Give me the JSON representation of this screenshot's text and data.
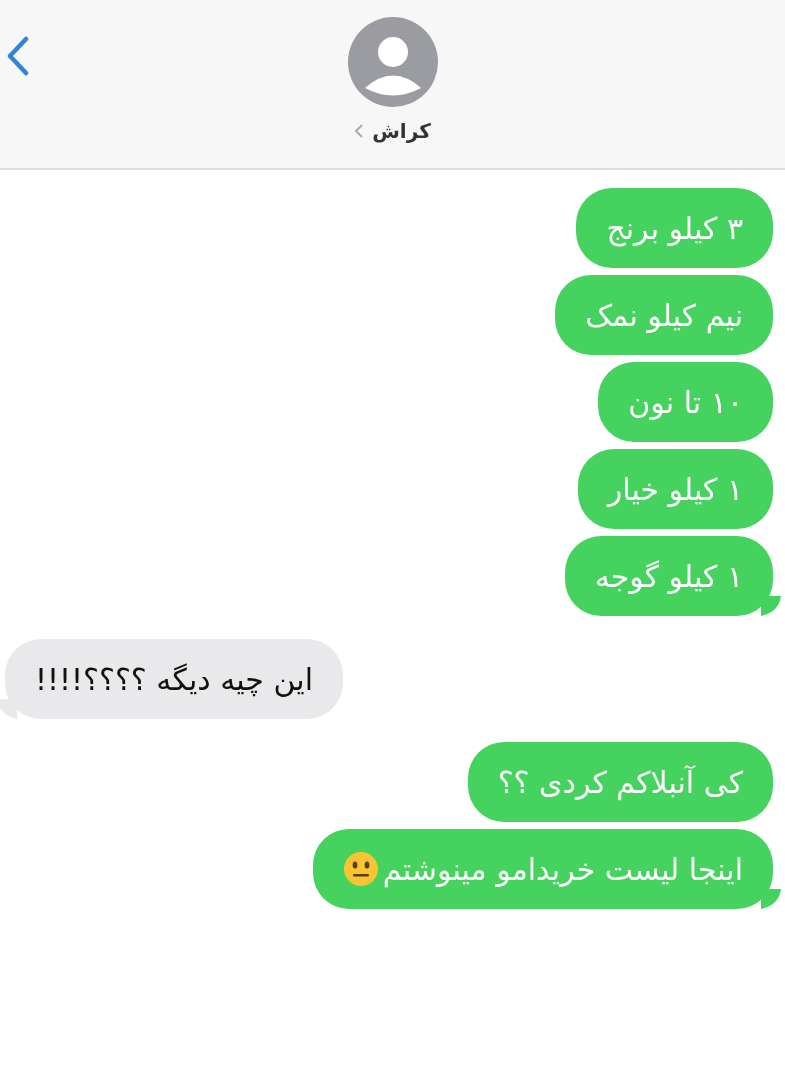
{
  "header": {
    "contact_name": "کراش",
    "back": true
  },
  "messages": [
    {
      "text": "۳ کیلو برنج",
      "kind": "sent",
      "tail": false,
      "emoji": false
    },
    {
      "text": "نیم کیلو نمک",
      "kind": "sent",
      "tail": false,
      "emoji": false
    },
    {
      "text": "۱۰ تا نون",
      "kind": "sent",
      "tail": false,
      "emoji": false
    },
    {
      "text": "۱ کیلو خیار",
      "kind": "sent",
      "tail": false,
      "emoji": false
    },
    {
      "text": "۱ کیلو گوجه",
      "kind": "sent",
      "tail": true,
      "emoji": false
    },
    {
      "text": "این چیه دیگه ؟؟؟؟!!!!",
      "kind": "received",
      "tail": true,
      "emoji": false
    },
    {
      "text": "کی آنبلاکم کردی ؟؟",
      "kind": "sent",
      "tail": false,
      "emoji": false
    },
    {
      "text": "اینجا لیست خریدامو مینوشتم",
      "kind": "sent",
      "tail": true,
      "emoji": true
    }
  ]
}
